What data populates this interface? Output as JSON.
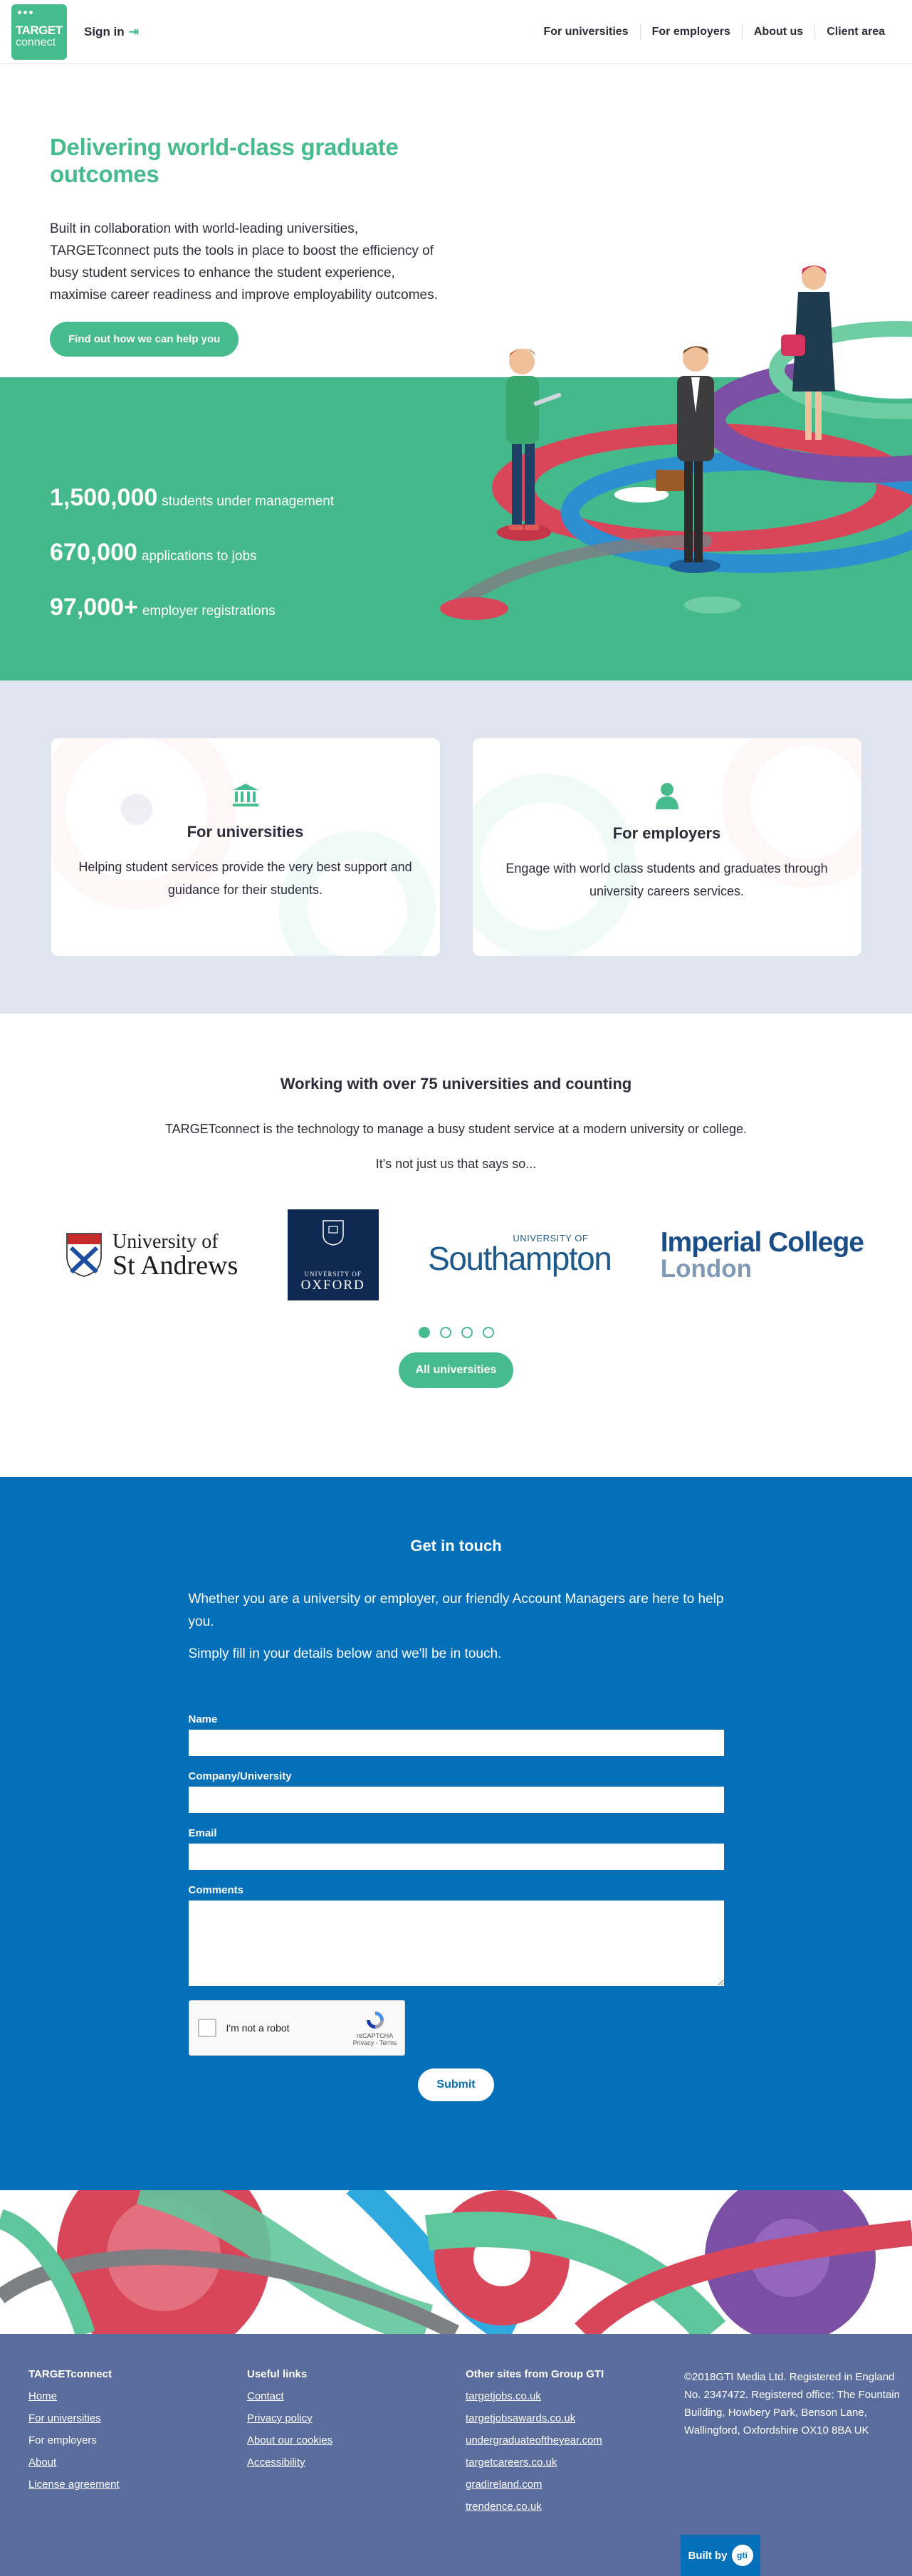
{
  "header": {
    "logo_line1": "TARGET",
    "logo_line2": "connect",
    "signin_label": "Sign in",
    "nav": [
      "For universities",
      "For employers",
      "About us",
      "Client area"
    ]
  },
  "hero": {
    "title": "Delivering world-class graduate outcomes",
    "body": "Built in collaboration with world-leading universities, TARGETconnect puts the tools in place to boost the efficiency of busy student services to enhance the student experience, maximise career readiness and improve employability outcomes.",
    "cta": "Find out how we can help you",
    "stats": [
      {
        "number": "1,500,000",
        "label": "students under management"
      },
      {
        "number": "670,000",
        "label": "applications to jobs"
      },
      {
        "number": "97,000+",
        "label": "employer registrations"
      }
    ]
  },
  "cards": [
    {
      "title": "For universities",
      "text": "Helping student services provide the very best support and guidance for their students.",
      "icon": "institution-icon"
    },
    {
      "title": "For employers",
      "text": "Engage with world class students and graduates through university careers services.",
      "icon": "person-icon"
    }
  ],
  "partners": {
    "title": "Working with over 75 universities and counting",
    "p1": "TARGETconnect is the technology to manage a busy student service at a modern university or college.",
    "p2": "It's not just us that says so...",
    "logos": {
      "st_andrews_1": "University of",
      "st_andrews_2": "St Andrews",
      "oxford_1": "UNIVERSITY OF",
      "oxford_2": "OXFORD",
      "southampton_1": "UNIVERSITY OF",
      "southampton_2": "Southampton",
      "imperial_1": "Imperial College",
      "imperial_2": "London"
    },
    "carousel_active": 1,
    "carousel_count": 4,
    "button": "All universities"
  },
  "contact": {
    "title": "Get in touch",
    "p1": "Whether you are a university or employer, our friendly Account Managers are here to help you.",
    "p2": "Simply fill in your details below and we'll be in touch.",
    "labels": {
      "name": "Name",
      "company": "Company/University",
      "email": "Email",
      "comments": "Comments"
    },
    "captcha_label": "I'm not a robot",
    "captcha_brand": "reCAPTCHA",
    "captcha_links": "Privacy - Terms",
    "submit": "Submit"
  },
  "footer": {
    "col1": {
      "title": "TARGETconnect",
      "links": [
        "Home",
        "For universities",
        "For employers",
        "About",
        "License agreement"
      ]
    },
    "col2": {
      "title": "Useful links",
      "links": [
        "Contact",
        "Privacy policy",
        "About our cookies",
        "Accessibility"
      ]
    },
    "col3": {
      "title": "Other sites from Group GTI",
      "links": [
        "targetjobs.co.uk",
        "targetjobsawards.co.uk",
        "undergraduateoftheyear.com",
        "targetcareers.co.uk",
        "gradireland.com",
        "trendence.co.uk"
      ]
    },
    "col4": {
      "text": "©2018GTI Media Ltd. Registered in England No. 2347472. Registered office: The Fountain Building, Howbery Park, Benson Lane, Wallingford, Oxfordshire OX10 8BA UK"
    },
    "built_by": "Built by",
    "gti": "gti"
  },
  "colors": {
    "brand_green": "#46bb8d",
    "contact_blue": "#0570ba",
    "footer": "#5a6d9c",
    "cards_band": "#dfe4ef"
  }
}
